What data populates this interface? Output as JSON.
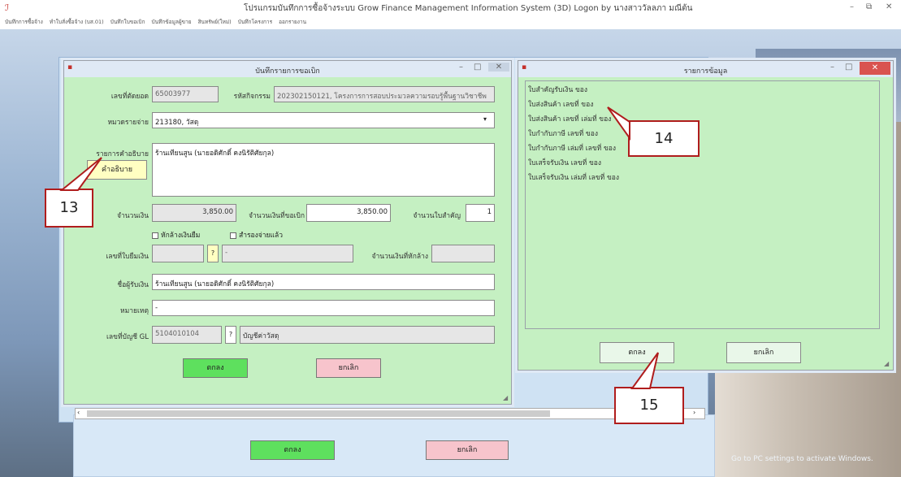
{
  "app": {
    "title": "โปรแกรมบันทึกการซื้อจ้างระบบ  Grow Finance Management Information System (3D) Logon by นางสาววัลลภา  มณีต้น"
  },
  "menu": [
    "บันทึกการซื้อจ้าง",
    "ทำใบสั่งซื้อจ้าง (บส.01)",
    "บันทึกใบขอเบิก",
    "บันทึกข้อมูลผู้ขาย",
    "สินทรัพย์(ใหม่)",
    "บันทึกโครงการ",
    "ออกรายงาน"
  ],
  "form": {
    "title": "บันทึกรายการขอเบิก",
    "ref_label": "เลขที่ตัดยอด",
    "ref_value": "65003977",
    "activity_label": "รหัสกิจกรรม",
    "activity_value": "202302150121, โครงการการสอบประมวลความรอบรู้พื้นฐานวิชาชีพ",
    "category_label": "หมวดรายจ่าย",
    "category_value": "213180, วัสดุ",
    "desc_label": "รายการคำอธิบาย",
    "desc_value": "ร้านเทียนสูน (นายอดิศักดิ์ คงนิรัติศัยกุล)",
    "desc_button": "คำอธิบาย",
    "amount_label": "จำนวนเงิน",
    "amount_value": "3,850.00",
    "withdraw_label": "จำนวนเงินที่ขอเบิก",
    "withdraw_value": "3,850.00",
    "receipts_label": "จำนวนใบสำคัญ",
    "receipts_value": "1",
    "cb_loan": "หักล้างเงินยืม",
    "cb_paid": "สำรองจ่ายแล้ว",
    "loan_no_label": "เลขที่ใบยืมเงิน",
    "loan_q": "?",
    "loan_dash": "-",
    "deduct_label": "จำนวนเงินที่หักล้าง",
    "payee_label": "ชื่อผู้รับเงิน",
    "payee_value": "ร้านเทียนสูน (นายอดิศักดิ์ คงนิรัติศัยกุล)",
    "note_label": "หมายเหตุ",
    "note_value": "-",
    "gl_label": "เลขที่บัญชี GL",
    "gl_value": "5104010104",
    "gl_q": "?",
    "gl_name": "บัญชีค่าวัสดุ",
    "ok": "ตกลง",
    "cancel": "ยกเลิก"
  },
  "list": {
    "title": "รายการข้อมูล",
    "items": [
      "ใบสำคัญรับเงิน ของ",
      "ใบส่งสินค้า เลขที่ ของ",
      "ใบส่งสินค้า เลขที่ เล่มที่ ของ",
      "ใบกำกับภาษี เลขที่ ของ",
      "ใบกำกับภาษี เล่มที่ เลขที่ ของ",
      "ใบเสร็จรับเงิน เลขที่ ของ",
      "ใบเสร็จรับเงิน เล่มที่ เลขที่ ของ"
    ],
    "ok": "ตกลง",
    "cancel": "ยกเลิก"
  },
  "bottom": {
    "ok": "ตกลง",
    "cancel": "ยกเลิก"
  },
  "callouts": {
    "c13": "13",
    "c14": "14",
    "c15": "15"
  },
  "watermark": "Go to PC settings to activate Windows."
}
